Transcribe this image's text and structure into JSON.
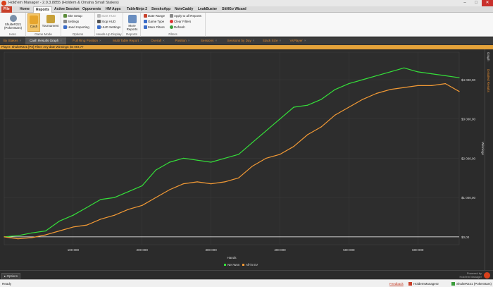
{
  "window": {
    "title": "Hold'em Manager - 2.0.3.8855 (Holdem & Omaha Small Stakes)"
  },
  "tabs": [
    "File",
    "Home",
    "Reports",
    "Active Session",
    "Opponents",
    "HM Apps",
    "TableNinja 2",
    "SeeskoApp",
    "NoteCaddy",
    "LeakBuster",
    "SitNGo Wizard"
  ],
  "ribbon": {
    "hero": {
      "label": "ShulteR221 (PokerStars)",
      "group": "Hero"
    },
    "gamemode": {
      "cash": "Cash",
      "tournament": "Tournament",
      "group": "Game Mode"
    },
    "options": {
      "site_setup": "Site Setup",
      "settings": "Settings",
      "hand_importing": "Hand Importing",
      "group": "Options"
    },
    "hud": {
      "start": "Start HUD",
      "stop": "Stop HUD",
      "settings": "HUD Settings",
      "group": "Heads-Up Display"
    },
    "reports": {
      "more": "More Reports",
      "group": "Reports"
    },
    "filters": {
      "date_range": "Date Range",
      "game_type": "Game Type",
      "more_filters": "More Filters",
      "apply_all": "Apply to all Reports",
      "clear": "Clear Filters",
      "refresh": "Refresh",
      "group": "Filters"
    }
  },
  "subtabs": [
    "By Stakes",
    "Cash Results Graph",
    "Full Ring Position",
    "Multi Table Report",
    "Overall",
    "Position",
    "Sessions",
    "Sessions by Day",
    "Stack Size",
    "VsPlayer"
  ],
  "filter_text": "Player: ShulteR221 [PS]  Filter: Any date  Winnings: $4 094,77",
  "right_panel": {
    "graph": "Graph",
    "graph_options": "Detailed Results"
  },
  "bottom": {
    "options": "Options",
    "powered": "Powered by",
    "brand": "Hold'em Manager"
  },
  "status": {
    "ready": "Ready",
    "feedback": "Feedback",
    "db": "HoldemManager2",
    "player": "ShulteR221 (PokerStars)"
  },
  "colors": {
    "net_won": "#35e03a",
    "allin_ev": "#f39a35",
    "zero_line": "#ffffff",
    "filter_bg": "#e5a33a",
    "accent": "#d9401b"
  },
  "chart_data": {
    "type": "line",
    "xlabel": "Hands",
    "ylabel": "Winnings",
    "xlim": [
      0,
      660000
    ],
    "ylim": [
      -200,
      4700
    ],
    "x_ticks": [
      {
        "v": 100000,
        "t": "100 000"
      },
      {
        "v": 200000,
        "t": "200 000"
      },
      {
        "v": 300000,
        "t": "300 000"
      },
      {
        "v": 400000,
        "t": "400 000"
      },
      {
        "v": 500000,
        "t": "500 000"
      },
      {
        "v": 600000,
        "t": "600 000"
      }
    ],
    "y_ticks": [
      {
        "v": 0,
        "t": "$0,00"
      },
      {
        "v": 1000,
        "t": "$1 000,00"
      },
      {
        "v": 2000,
        "t": "$2 000,00"
      },
      {
        "v": 3000,
        "t": "$3 000,00"
      },
      {
        "v": 4000,
        "t": "$4 000,00"
      }
    ],
    "legend_position": "bottom",
    "series": [
      {
        "name": "Net Won",
        "color": "#35e03a",
        "x": [
          0,
          20000,
          40000,
          60000,
          80000,
          100000,
          120000,
          140000,
          160000,
          180000,
          200000,
          220000,
          240000,
          260000,
          280000,
          300000,
          320000,
          340000,
          360000,
          380000,
          400000,
          420000,
          440000,
          460000,
          480000,
          500000,
          520000,
          540000,
          560000,
          580000,
          600000,
          620000,
          640000,
          660000
        ],
        "y": [
          0,
          30,
          100,
          150,
          400,
          550,
          750,
          950,
          1000,
          1150,
          1300,
          1700,
          1900,
          2000,
          1950,
          1900,
          2000,
          2100,
          2400,
          2700,
          3000,
          3300,
          3350,
          3500,
          3750,
          3900,
          4000,
          4100,
          4200,
          4300,
          4200,
          4150,
          4100,
          4050
        ]
      },
      {
        "name": "All-in EV",
        "color": "#f39a35",
        "x": [
          0,
          20000,
          40000,
          60000,
          80000,
          100000,
          120000,
          140000,
          160000,
          180000,
          200000,
          220000,
          240000,
          260000,
          280000,
          300000,
          320000,
          340000,
          360000,
          380000,
          400000,
          420000,
          440000,
          460000,
          480000,
          500000,
          520000,
          540000,
          560000,
          580000,
          600000,
          620000,
          640000,
          660000
        ],
        "y": [
          0,
          -50,
          -20,
          50,
          150,
          250,
          300,
          450,
          550,
          700,
          800,
          1000,
          1200,
          1350,
          1400,
          1350,
          1400,
          1500,
          1800,
          2000,
          2100,
          2300,
          2600,
          2800,
          3100,
          3300,
          3500,
          3650,
          3750,
          3800,
          3850,
          3850,
          3900,
          3700
        ]
      }
    ]
  }
}
